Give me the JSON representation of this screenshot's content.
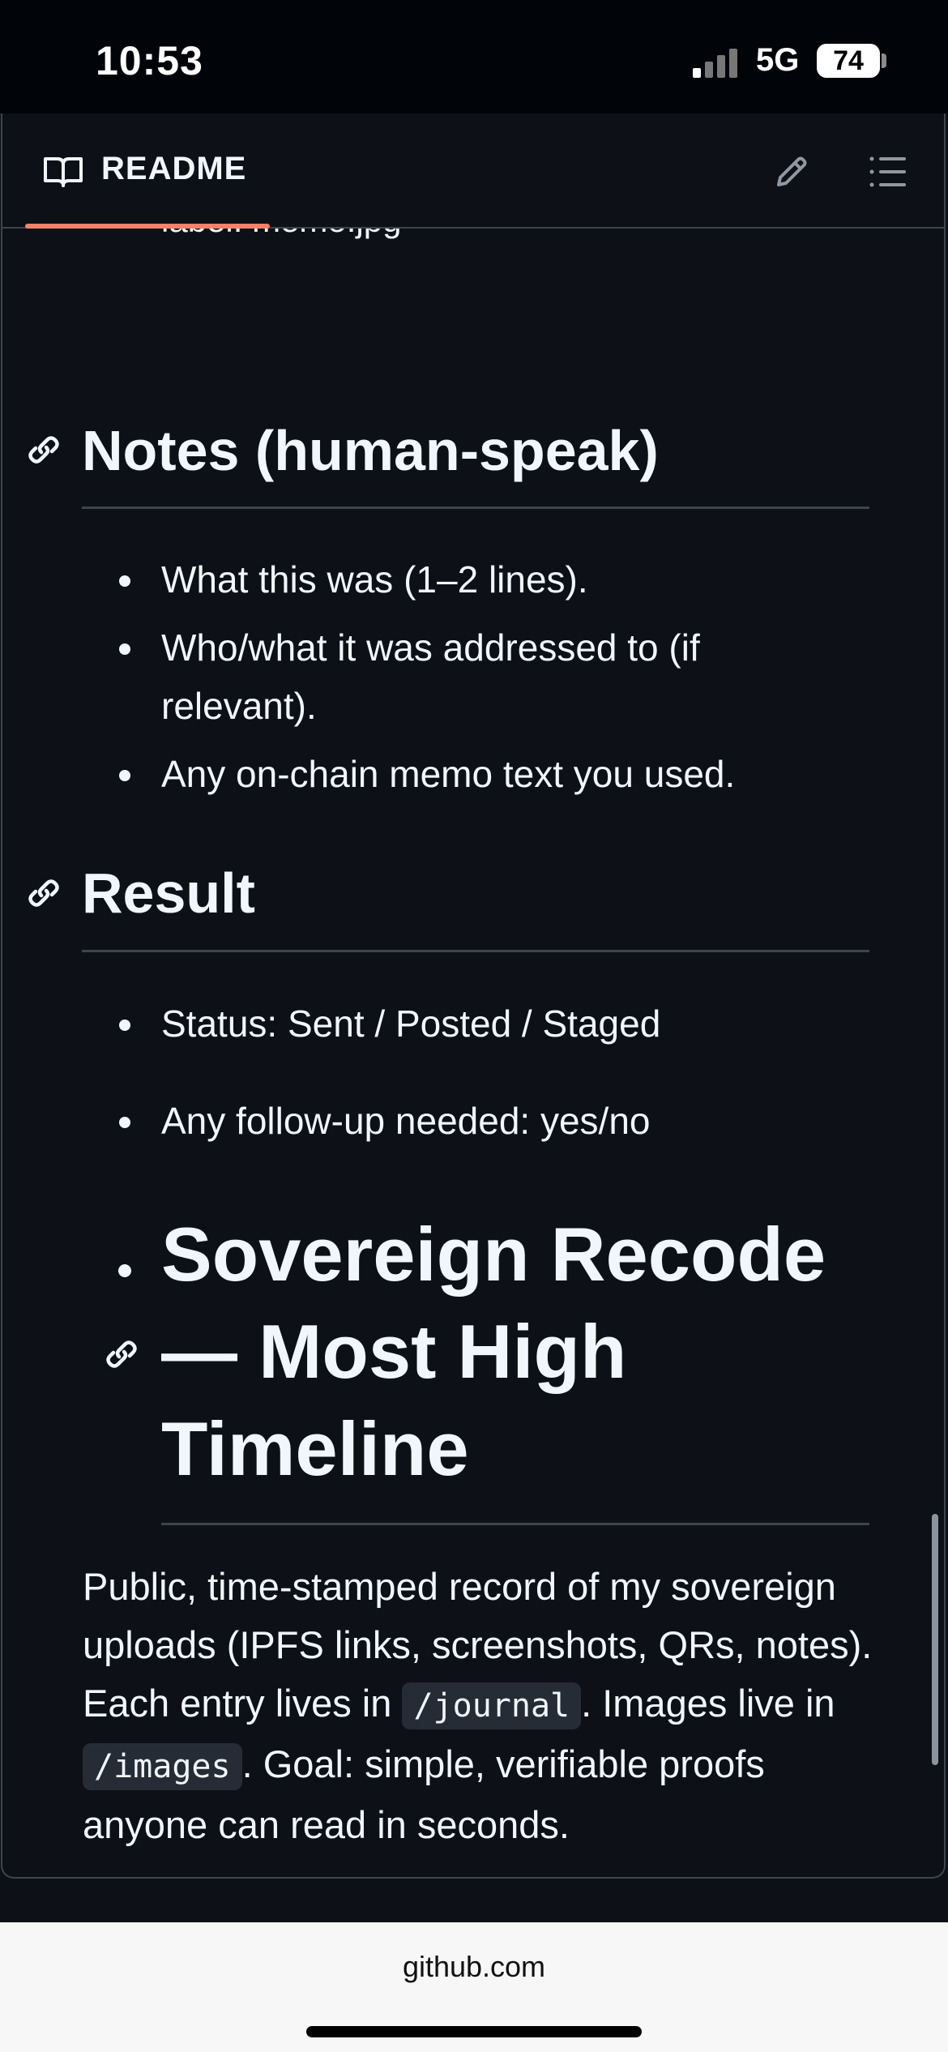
{
  "status_bar": {
    "time": "10:53",
    "network": "5G",
    "battery": "74"
  },
  "readme": {
    "tab_label": "README",
    "cut_text": "label: memo.jpg",
    "notes": {
      "heading": "Notes (human-speak)",
      "items": [
        "What this was (1–2 lines).",
        "Who/what it was addressed to (if relevant).",
        "Any on-chain memo text you used."
      ]
    },
    "result": {
      "heading": "Result",
      "items": [
        "Status: Sent / Posted / Staged",
        "Any follow-up needed: yes/no"
      ]
    },
    "title_lines": [
      "Sovereign Recode",
      "— Most High",
      "Timeline"
    ],
    "intro": {
      "text1": "Public, time-stamped record of my sovereign uploads (IPFS links, screenshots, QRs, notes). Each entry lives in ",
      "code1": "/journal",
      "text2": ". Images live in ",
      "code2": "/images",
      "text3": ". Goal: simple, verifiable proofs anyone can read in seconds."
    }
  },
  "browser": {
    "domain": "github.com"
  },
  "icons": {
    "book": "book-icon",
    "edit": "pencil-icon",
    "outline": "list-icon",
    "anchor": "link-icon"
  },
  "colors": {
    "accent": "#f78166",
    "background": "#0d1117",
    "border": "#3d444d",
    "text": "#f0f6fc"
  }
}
